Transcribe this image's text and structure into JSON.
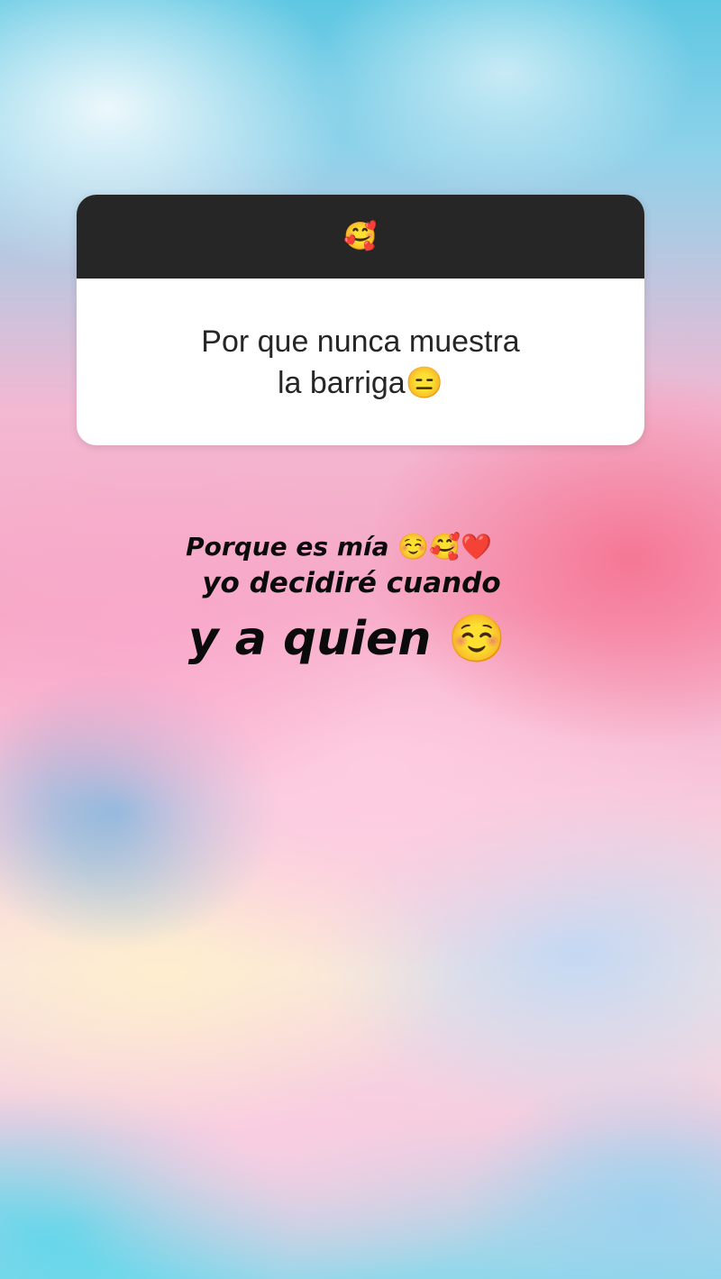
{
  "question_sticker": {
    "header_emoji": "🥰",
    "question_line_1": "Por que nunca muestra",
    "question_line_2": "la barriga",
    "question_line_2_emoji": "😑"
  },
  "answer": {
    "line_1": "Porque es mía",
    "line_1_emojis": "☺️🥰❤️",
    "line_2": "yo decidiré cuando",
    "line_3": "y a quien",
    "line_3_emoji": "☺️"
  },
  "background": {
    "description_colors": [
      "#5ec7e2",
      "#f6a7c4",
      "#f8e4df",
      "#8fd8ea"
    ]
  }
}
